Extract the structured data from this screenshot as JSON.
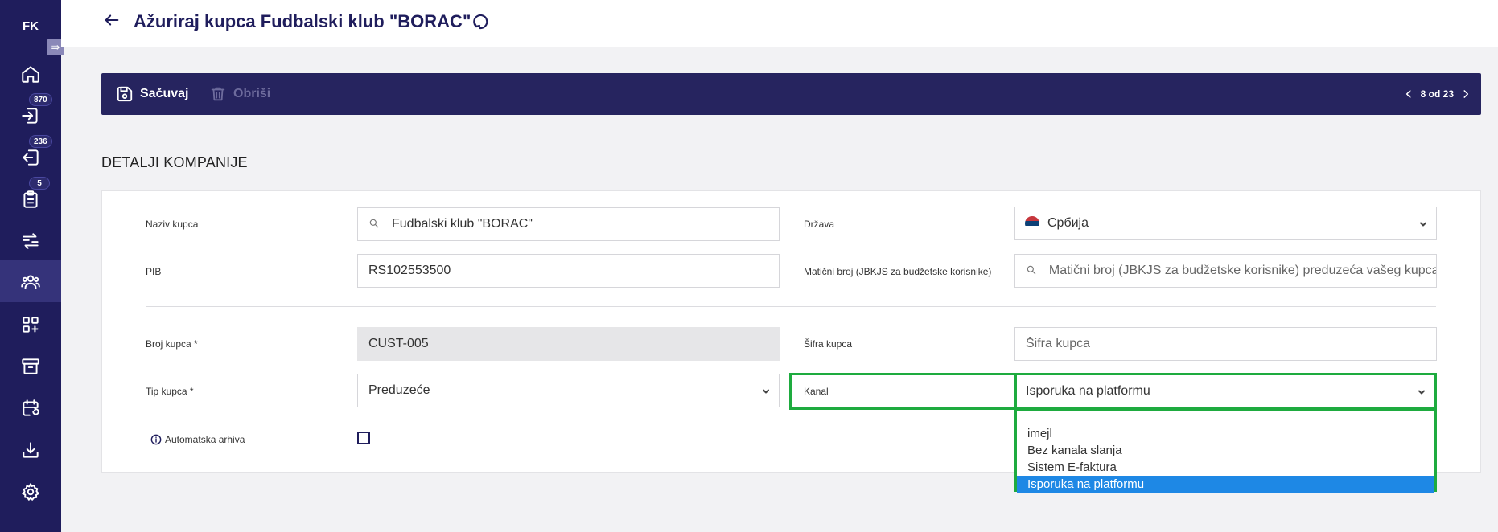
{
  "sidebar": {
    "logo": "FK",
    "collapse_icon": "expand-icon",
    "items": [
      {
        "icon": "home-icon",
        "badge": ""
      },
      {
        "icon": "inbox-in-icon",
        "badge": "870"
      },
      {
        "icon": "outbox-icon",
        "badge": "236"
      },
      {
        "icon": "clipboard-icon",
        "badge": "5"
      },
      {
        "icon": "transfer-icon",
        "badge": ""
      },
      {
        "icon": "customers-icon",
        "badge": ""
      },
      {
        "icon": "apps-add-icon",
        "badge": ""
      },
      {
        "icon": "archive-icon",
        "badge": ""
      },
      {
        "icon": "calendar-sync-icon",
        "badge": ""
      },
      {
        "icon": "download-icon",
        "badge": ""
      },
      {
        "icon": "settings-icon",
        "badge": ""
      }
    ]
  },
  "header": {
    "title": "Ažuriraj kupca Fudbalski klub \"BORAC\""
  },
  "toolbar": {
    "save_label": "Sačuvaj",
    "delete_label": "Obriši",
    "pager": "8 od 23"
  },
  "section": {
    "title": "DETALJI KOMPANIJE"
  },
  "form": {
    "customer_name_label": "Naziv kupca",
    "customer_name_value": "Fudbalski klub \"BORAC\"",
    "country_label": "Država",
    "country_value": "Србија",
    "pib_label": "PIB",
    "pib_value": "RS102553500",
    "registry_label": "Matični broj (JBKJS za budžetske korisnike)",
    "registry_placeholder": "Matični broj (JBKJS za budžetske korisnike) preduzeća vašeg kupca",
    "customer_number_label": "Broj kupca *",
    "customer_number_value": "CUST-005",
    "customer_code_label": "Šifra kupca",
    "customer_code_placeholder": "Šifra kupca",
    "customer_type_label": "Tip kupca *",
    "customer_type_value": "Preduzeće",
    "channel_label": "Kanal",
    "channel_value": "Isporuka na platformu",
    "auto_archive_label": "Automatska arhiva"
  },
  "channel_dropdown": {
    "options": [
      "imejl",
      "Bez kanala slanja",
      "Sistem E-faktura",
      "Isporuka na platformu"
    ],
    "selected_index": 3
  },
  "colors": {
    "sidebar_bg": "#1f1d5c",
    "toolbar_bg": "#26245f",
    "highlight": "#1eab3f",
    "selected_option": "#1e88e5"
  }
}
